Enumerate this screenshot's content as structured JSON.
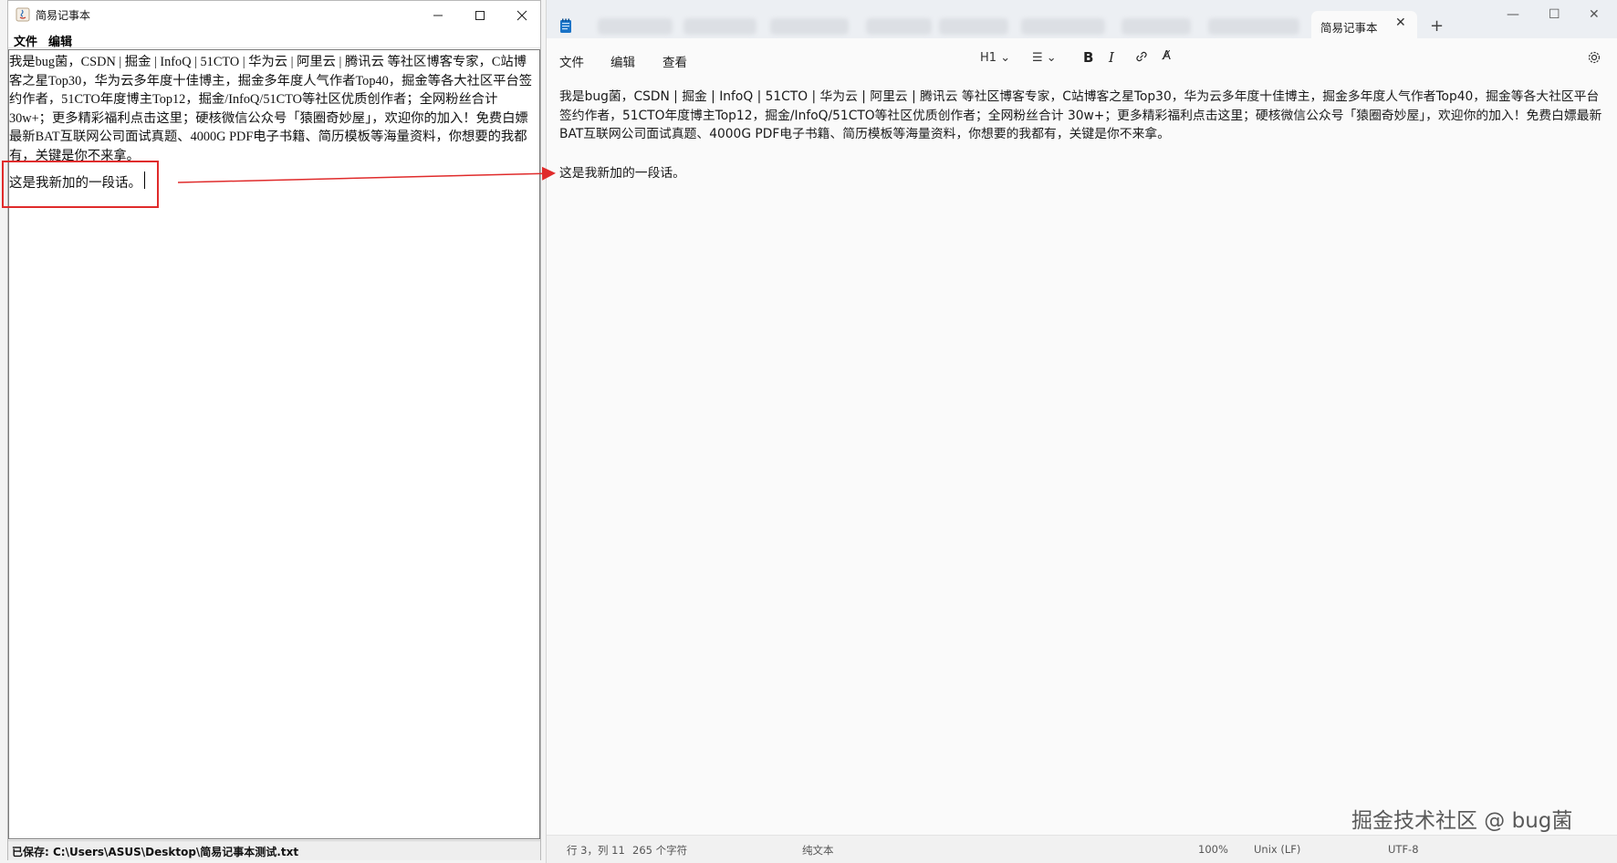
{
  "left_window": {
    "title": "简易记事本",
    "menu": [
      "文件",
      "编辑"
    ],
    "paragraph1": "我是bug菌，CSDN | 掘金 | InfoQ | 51CTO | 华为云 | 阿里云 | 腾讯云 等社区博客专家，C站博客之星Top30，华为云多年度十佳博主，掘金多年度人气作者Top40，掘金等各大社区平台签约作者，51CTO年度博主Top12，掘金/InfoQ/51CTO等社区优质创作者；全网粉丝合计 30w+；更多精彩福利点击这里；硬核微信公众号「猿圈奇妙屋」，欢迎你的加入！免费白嫖最新BAT互联网公司面试真题、4000G PDF电子书籍、简历模板等海量资料，你想要的我都有，关键是你不来拿。",
    "paragraph2": "这是我新加的一段话。",
    "status": "已保存: C:\\Users\\ASUS\\Desktop\\简易记事本测试.txt"
  },
  "right_window": {
    "active_tab": "简易记事本",
    "menu": [
      "文件",
      "编辑",
      "查看"
    ],
    "toolbar": {
      "heading": "H1",
      "list": "☰",
      "bold": "B",
      "italic": "I",
      "clear": "A̸"
    },
    "paragraph1": "我是bug菌，CSDN | 掘金 | InfoQ | 51CTO | 华为云 | 阿里云 | 腾讯云 等社区博客专家，C站博客之星Top30，华为云多年度十佳博主，掘金多年度人气作者Top40，掘金等各大社区平台签约作者，51CTO年度博主Top12，掘金/InfoQ/51CTO等社区优质创作者；全网粉丝合计 30w+；更多精彩福利点击这里；硬核微信公众号「猿圈奇妙屋」，欢迎你的加入！免费白嫖最新BAT互联网公司面试真题、4000G PDF电子书籍、简历模板等海量资料，你想要的我都有，关键是你不来拿。",
    "paragraph2": "这是我新加的一段话。",
    "status": {
      "position": "行 3，列 11",
      "chars": "265 个字符",
      "mode": "纯文本",
      "zoom": "100%",
      "eol": "Unix (LF)",
      "encoding": "UTF-8"
    }
  },
  "watermark": "掘金技术社区 @ bug菌",
  "colors": {
    "highlight": "#e02b2b",
    "notepad_accent": "#1a73c7"
  },
  "icons": [
    "java-app-icon",
    "minimize-icon",
    "maximize-icon",
    "close-icon",
    "notepad-icon",
    "plus-icon",
    "link-icon",
    "settings-icon",
    "arrow-annotation"
  ]
}
